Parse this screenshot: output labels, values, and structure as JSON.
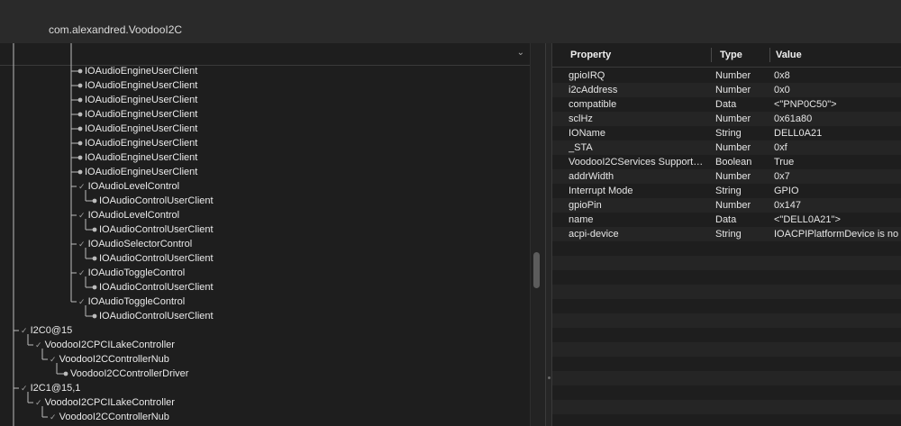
{
  "window": {
    "top_cut_text": "                                  ",
    "subtitle": "com.alexandred.VoodooI2C"
  },
  "tree": {
    "sort_indicator": "chevron-down-icon",
    "rows": [
      {
        "label": "IOAudioEngineUserClient",
        "depth": 4,
        "kind": "leaf"
      },
      {
        "label": "IOAudioEngineUserClient",
        "depth": 4,
        "kind": "leaf"
      },
      {
        "label": "IOAudioEngineUserClient",
        "depth": 4,
        "kind": "leaf"
      },
      {
        "label": "IOAudioEngineUserClient",
        "depth": 4,
        "kind": "leaf"
      },
      {
        "label": "IOAudioEngineUserClient",
        "depth": 4,
        "kind": "leaf"
      },
      {
        "label": "IOAudioEngineUserClient",
        "depth": 4,
        "kind": "leaf"
      },
      {
        "label": "IOAudioEngineUserClient",
        "depth": 4,
        "kind": "leaf"
      },
      {
        "label": "IOAudioEngineUserClient",
        "depth": 4,
        "kind": "leaf"
      },
      {
        "label": "IOAudioLevelControl",
        "depth": 4,
        "kind": "open"
      },
      {
        "label": "IOAudioControlUserClient",
        "depth": 5,
        "kind": "leaf"
      },
      {
        "label": "IOAudioLevelControl",
        "depth": 4,
        "kind": "open"
      },
      {
        "label": "IOAudioControlUserClient",
        "depth": 5,
        "kind": "leaf"
      },
      {
        "label": "IOAudioSelectorControl",
        "depth": 4,
        "kind": "open"
      },
      {
        "label": "IOAudioControlUserClient",
        "depth": 5,
        "kind": "leaf"
      },
      {
        "label": "IOAudioToggleControl",
        "depth": 4,
        "kind": "open"
      },
      {
        "label": "IOAudioControlUserClient",
        "depth": 5,
        "kind": "leaf"
      },
      {
        "label": "IOAudioToggleControl",
        "depth": 4,
        "kind": "open"
      },
      {
        "label": "IOAudioControlUserClient",
        "depth": 5,
        "kind": "leaf"
      },
      {
        "label": "I2C0@15",
        "depth": 0,
        "kind": "open"
      },
      {
        "label": "VoodooI2CPCILakeController",
        "depth": 1,
        "kind": "open"
      },
      {
        "label": "VoodooI2CControllerNub",
        "depth": 2,
        "kind": "open"
      },
      {
        "label": "VoodooI2CControllerDriver",
        "depth": 3,
        "kind": "leaf"
      },
      {
        "label": "I2C1@15,1",
        "depth": 0,
        "kind": "open"
      },
      {
        "label": "VoodooI2CPCILakeController",
        "depth": 1,
        "kind": "open"
      },
      {
        "label": "VoodooI2CControllerNub",
        "depth": 2,
        "kind": "open"
      }
    ]
  },
  "properties": {
    "columns": {
      "property": "Property",
      "type": "Type",
      "value": "Value"
    },
    "rows": [
      {
        "property": "gpioIRQ",
        "type": "Number",
        "value": "0x8"
      },
      {
        "property": "i2cAddress",
        "type": "Number",
        "value": "0x0"
      },
      {
        "property": "compatible",
        "type": "Data",
        "value": "<\"PNP0C50\">"
      },
      {
        "property": "sclHz",
        "type": "Number",
        "value": "0x61a80"
      },
      {
        "property": "IOName",
        "type": "String",
        "value": "DELL0A21"
      },
      {
        "property": "_STA",
        "type": "Number",
        "value": "0xf"
      },
      {
        "property": "VoodooI2CServices Support…",
        "type": "Boolean",
        "value": "True"
      },
      {
        "property": "addrWidth",
        "type": "Number",
        "value": "0x7"
      },
      {
        "property": "Interrupt Mode",
        "type": "String",
        "value": "GPIO"
      },
      {
        "property": "gpioPin",
        "type": "Number",
        "value": "0x147"
      },
      {
        "property": "name",
        "type": "Data",
        "value": "<\"DELL0A21\">"
      },
      {
        "property": "acpi-device",
        "type": "String",
        "value": "IOACPIPlatformDevice is no"
      }
    ]
  }
}
